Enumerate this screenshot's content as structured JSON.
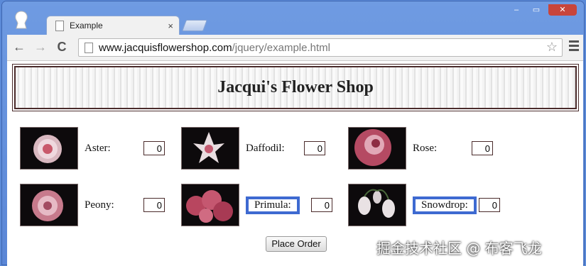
{
  "browser": {
    "tab_title": "Example",
    "tab_close": "×",
    "url_host": "www.jacquisflowershop.com",
    "url_path": "/jquery/example.html",
    "nav": {
      "back": "←",
      "forward": "→",
      "reload": "C"
    },
    "star": "☆",
    "window_controls": {
      "minimize": "‒",
      "maximize": "▭",
      "close": "✕"
    }
  },
  "page": {
    "title": "Jacqui's Flower Shop",
    "flowers": [
      {
        "label": "Aster:",
        "quantity": "0"
      },
      {
        "label": "Daffodil:",
        "quantity": "0"
      },
      {
        "label": "Rose:",
        "quantity": "0"
      },
      {
        "label": "Peony:",
        "quantity": "0"
      },
      {
        "label": "Primula:",
        "quantity": "0"
      },
      {
        "label": "Snowdrop:",
        "quantity": "0"
      }
    ],
    "order_button": "Place Order"
  },
  "watermark": "掘金技术社区 @ 布客飞龙",
  "colors": {
    "highlight": "#3e6ad1",
    "frame": "#5b8ad8",
    "banner_border": "#4a2b2b"
  }
}
